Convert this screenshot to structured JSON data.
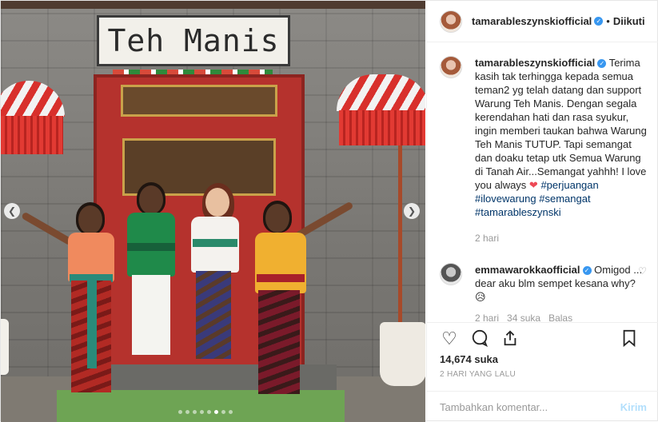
{
  "photo": {
    "sign_text": "Teh Manis",
    "carousel": {
      "count": 8,
      "active_index": 5
    }
  },
  "header": {
    "username": "tamarableszynskiofficial",
    "separator": "•",
    "follow_label": "Diikuti"
  },
  "caption": {
    "username": "tamarableszynskiofficial",
    "text": "Terima kasih tak terhingga kepada semua teman2 yg telah datang dan support Warung Teh Manis. Dengan segala kerendahan hati dan rasa syukur, ingin memberi taukan bahwa Warung Teh Manis TUTUP. Tapi semangat dan doaku tetap utk Semua Warung di Tanah Air...Semangat yahhh! I love you always ",
    "heart": "❤",
    "hashtags": [
      "#perjuangan",
      "#ilovewarung",
      "#semangat",
      "#tamarableszynski"
    ],
    "time": "2 hari"
  },
  "comment": {
    "username": "emmawarokkaofficial",
    "text": "Omigod ... dear aku blm sempet kesana why? 😥",
    "time": "2 hari",
    "likes": "34 suka",
    "reply": "Balas"
  },
  "likes_text": "14,674 suka",
  "date_text": "2 HARI YANG LALU",
  "add_comment": {
    "placeholder": "Tambahkan komentar...",
    "send_label": "Kirim"
  },
  "icons": {
    "like": "heart-icon",
    "comment": "comment-icon",
    "share": "share-icon",
    "save": "bookmark-icon"
  }
}
